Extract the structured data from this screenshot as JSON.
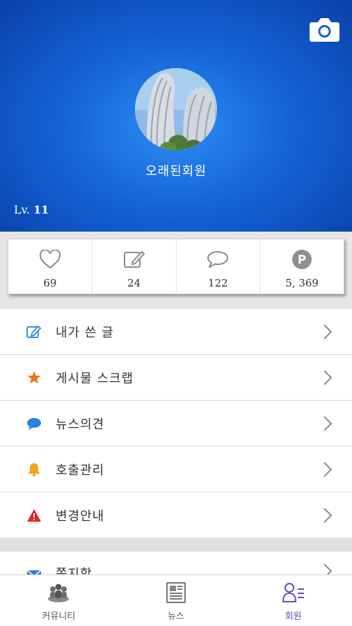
{
  "profile": {
    "nickname": "오래된회원",
    "level_prefix": "Lv.",
    "level_value": "11"
  },
  "stats": [
    {
      "icon": "heart-icon",
      "value": "69"
    },
    {
      "icon": "edit-icon",
      "value": "24"
    },
    {
      "icon": "comment-icon",
      "value": "122"
    },
    {
      "icon": "point-icon",
      "value": "5, 369"
    }
  ],
  "menu": [
    {
      "icon": "pencil-icon",
      "label": "내가 쓴 글",
      "color": "#3d8fe0"
    },
    {
      "icon": "star-icon",
      "label": "게시물 스크랩",
      "color": "#f0741e"
    },
    {
      "icon": "speech-bubble-icon",
      "label": "뉴스의견",
      "color": "#2a86d8"
    },
    {
      "icon": "bell-icon",
      "label": "호출관리",
      "color": "#f2a21c"
    },
    {
      "icon": "warning-icon",
      "label": "변경안내",
      "color": "#e32424"
    }
  ],
  "menu_partial": {
    "icon": "envelope-icon",
    "label": "쪽지함",
    "color": "#2a7fd6"
  },
  "bottom_nav": [
    {
      "icon": "community-icon",
      "label": "커뮤니티"
    },
    {
      "icon": "news-icon",
      "label": "뉴스"
    },
    {
      "icon": "member-icon",
      "label": "회원",
      "active": true
    }
  ],
  "colors": {
    "header": "#1464d8",
    "active_nav": "#5a52c8"
  }
}
